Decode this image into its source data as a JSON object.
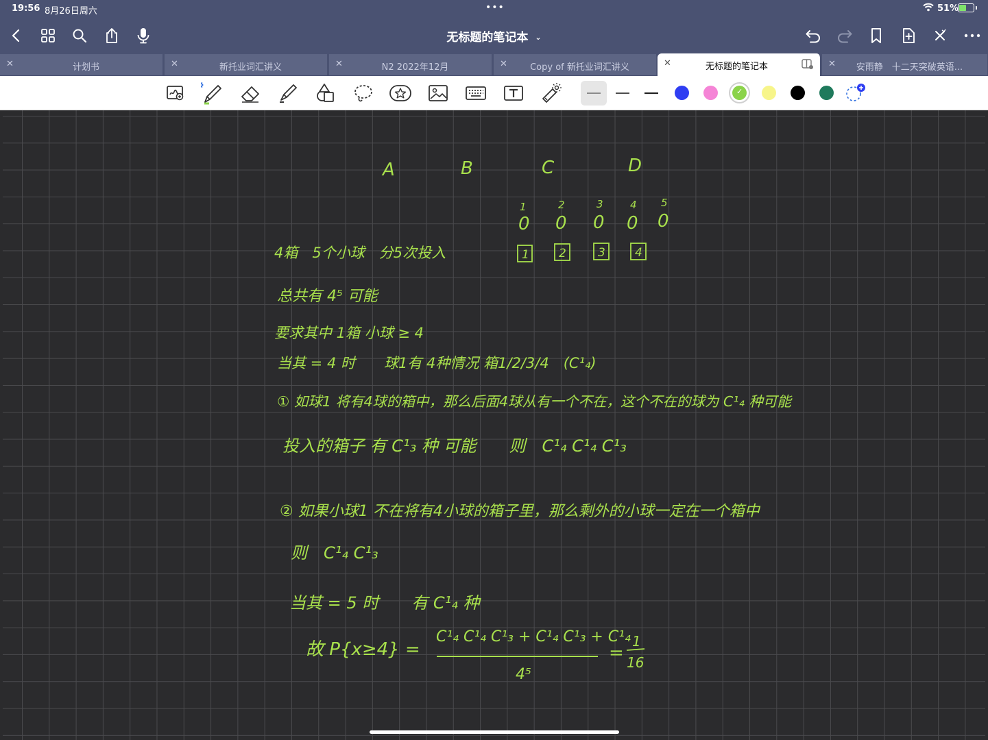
{
  "status_bar": {
    "time": "19:56",
    "date": "8月26日周六",
    "dots": "•••",
    "battery_pct": "51%",
    "battery_level": 0.51
  },
  "nav_bar": {
    "title": "无标题的笔记本",
    "icons_left": [
      "back-icon",
      "grid-icon",
      "search-icon",
      "share-icon",
      "mic-icon"
    ],
    "icons_right": [
      "undo-icon",
      "redo-icon",
      "bookmark-icon",
      "add-page-icon",
      "close-icon",
      "more-icon"
    ]
  },
  "tabs": [
    {
      "label": "计划书",
      "active": false
    },
    {
      "label": "新托业词汇讲义",
      "active": false
    },
    {
      "label": "N2 2022年12月",
      "active": false
    },
    {
      "label": "Copy of 新托业词汇讲义",
      "active": false
    },
    {
      "label": "无标题的笔记本",
      "active": true
    },
    {
      "label": "安雨静　十二天突破英语...",
      "active": false
    }
  ],
  "toolbar": {
    "tools": [
      "zoom-window-tool",
      "pen-tool",
      "eraser-tool",
      "highlighter-tool",
      "shapes-tool",
      "lasso-tool",
      "sticker-tool",
      "image-tool",
      "keyboard-tool",
      "text-tool",
      "laser-pointer-tool"
    ],
    "colors": [
      "#2f3ef2",
      "#f584d6",
      "#8bd34a",
      "#f7f58a",
      "#000000",
      "#1f7a5c"
    ],
    "selected_color": "#8bd34a",
    "ink_color": "#a8e04c"
  },
  "notes": {
    "header_letters": [
      "A",
      "B",
      "C",
      "D"
    ],
    "balls": [
      "0",
      "0",
      "0",
      "0",
      "0"
    ],
    "ball_indices": [
      "1",
      "2",
      "3",
      "4",
      "5"
    ],
    "boxes": [
      "1",
      "2",
      "3",
      "4"
    ],
    "line1": "4箱　5个小球　分5次投入",
    "line2": "总共有 4⁵ 可能",
    "line3": "要求其中 1箱 小球 ≥ 4",
    "line4": "当其 = 4 时　　球1有 4种情况 箱1/2/3/4　(C¹₄)",
    "line5": "① 如球1 将有4球的箱中，那么后面4球从有一个不在，这个不在的球为 C¹₄ 种可能",
    "line6": "投入的箱子 有 C¹₃ 种 可能　　则　C¹₄ C¹₄ C¹₃",
    "line7": "② 如果小球1 不在将有4小球的箱子里，那么剩外的小球一定在一个箱中",
    "line8": "则　C¹₄ C¹₃",
    "line9": "当其 = 5 时　　有 C¹₄ 种",
    "line10_left": "故 P{x≥4} =",
    "line10_numerator": "C¹₄ C¹₄ C¹₃ + C¹₄ C¹₃ + C¹₄",
    "line10_denominator": "4⁵",
    "line10_result_num": "1",
    "line10_result_den": "16"
  }
}
